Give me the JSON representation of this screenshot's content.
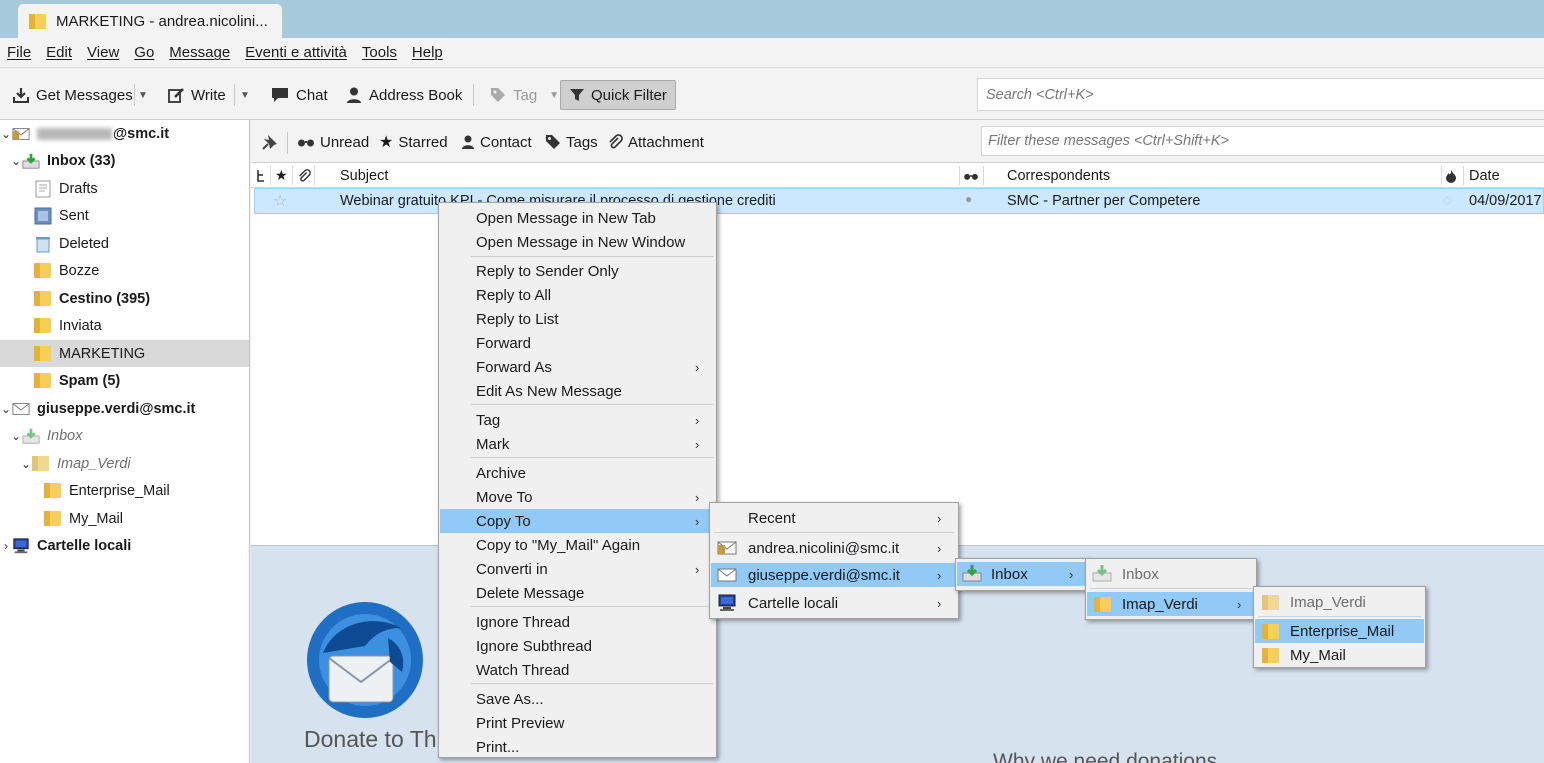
{
  "window": {
    "tab_title": "MARKETING - andrea.nicolini..."
  },
  "menubar": [
    "File",
    "Edit",
    "View",
    "Go",
    "Message",
    "Eventi e attività",
    "Tools",
    "Help"
  ],
  "toolbar": {
    "get_messages": "Get Messages",
    "write": "Write",
    "chat": "Chat",
    "address_book": "Address Book",
    "tag": "Tag",
    "quick_filter": "Quick Filter",
    "search_placeholder": "Search <Ctrl+K>"
  },
  "folders": {
    "account1": "@smc.it",
    "inbox1": "Inbox (33)",
    "drafts": "Drafts",
    "sent": "Sent",
    "deleted": "Deleted",
    "bozze": "Bozze",
    "cestino": "Cestino (395)",
    "inviata": "Inviata",
    "marketing": "MARKETING",
    "spam": "Spam (5)",
    "account2": "giuseppe.verdi@smc.it",
    "inbox2": "Inbox",
    "imap_verdi": "Imap_Verdi",
    "enterprise_mail": "Enterprise_Mail",
    "my_mail": "My_Mail",
    "local": "Cartelle locali"
  },
  "quickfilter": {
    "unread": "Unread",
    "starred": "Starred",
    "contact": "Contact",
    "tags": "Tags",
    "attachment": "Attachment",
    "filter_placeholder": "Filter these messages <Ctrl+Shift+K>"
  },
  "columns": {
    "subject": "Subject",
    "correspondents": "Correspondents",
    "date": "Date"
  },
  "message": {
    "subject": "Webinar gratuito KPI - Come misurare il processo di gestione crediti",
    "correspondent": "SMC - Partner per Competere",
    "date": "04/09/2017"
  },
  "startpage": {
    "donate": "Donate to Thunderbird",
    "why": "Why we need donations"
  },
  "context_menu": {
    "open_tab": "Open Message in New Tab",
    "open_window": "Open Message in New Window",
    "reply_sender": "Reply to Sender Only",
    "reply_all": "Reply to All",
    "reply_list": "Reply to List",
    "forward": "Forward",
    "forward_as": "Forward As",
    "edit_new": "Edit As New Message",
    "tag": "Tag",
    "mark": "Mark",
    "archive": "Archive",
    "move_to": "Move To",
    "copy_to": "Copy To",
    "copy_again": "Copy to \"My_Mail\" Again",
    "converti": "Converti in",
    "delete": "Delete Message",
    "ignore_thread": "Ignore Thread",
    "ignore_subthread": "Ignore Subthread",
    "watch_thread": "Watch Thread",
    "save_as": "Save As...",
    "print_preview": "Print Preview",
    "print": "Print..."
  },
  "copy_submenu": {
    "recent": "Recent",
    "account1": "andrea.nicolini@smc.it",
    "account2": "giuseppe.verdi@smc.it",
    "local": "Cartelle locali"
  },
  "account_submenu": {
    "inbox": "Inbox"
  },
  "inbox_submenu": {
    "inbox": "Inbox",
    "imap_verdi": "Imap_Verdi"
  },
  "imap_submenu": {
    "imap_verdi": "Imap_Verdi",
    "enterprise_mail": "Enterprise_Mail",
    "my_mail": "My_Mail"
  }
}
